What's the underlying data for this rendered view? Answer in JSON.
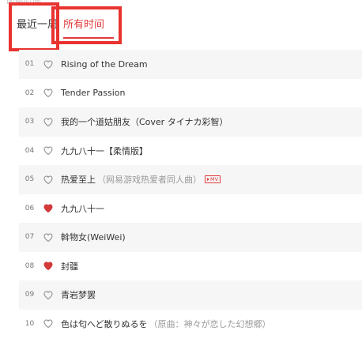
{
  "header": {
    "partial_text": "收藏时间"
  },
  "tabs": [
    {
      "label": "最近一周",
      "active": false
    },
    {
      "label": "所有时间",
      "active": true
    }
  ],
  "colors": {
    "accent": "#e03a3a",
    "highlight_box": "#e8332f",
    "heart_liked": "#d33a3a",
    "heart_outline": "#888888"
  },
  "tracks": [
    {
      "index": "01",
      "title": "Rising of the Dream",
      "subtitle": "",
      "liked": false,
      "mv": false
    },
    {
      "index": "02",
      "title": "Tender Passion",
      "subtitle": "",
      "liked": false,
      "mv": false
    },
    {
      "index": "03",
      "title": "我的一个道姑朋友（Cover タイナカ彩智）",
      "subtitle": "",
      "liked": false,
      "mv": false
    },
    {
      "index": "04",
      "title": "九九八十一【柔情版】",
      "subtitle": "",
      "liked": false,
      "mv": false
    },
    {
      "index": "05",
      "title": "热爱至上",
      "subtitle": "（网易游戏热爱者同人曲）",
      "liked": false,
      "mv": true,
      "mv_label": "MV"
    },
    {
      "index": "06",
      "title": "九九八十一",
      "subtitle": "",
      "liked": true,
      "mv": false
    },
    {
      "index": "07",
      "title": "斡物女(WeiWei)",
      "subtitle": "",
      "liked": false,
      "mv": false
    },
    {
      "index": "08",
      "title": "封疆",
      "subtitle": "",
      "liked": true,
      "mv": false
    },
    {
      "index": "09",
      "title": "青岩梦罢",
      "subtitle": "",
      "liked": false,
      "mv": false
    },
    {
      "index": "10",
      "title": "色は匂へど散りぬるを",
      "subtitle": "（原曲：神々が恋した幻想郷）",
      "liked": false,
      "mv": false
    }
  ]
}
